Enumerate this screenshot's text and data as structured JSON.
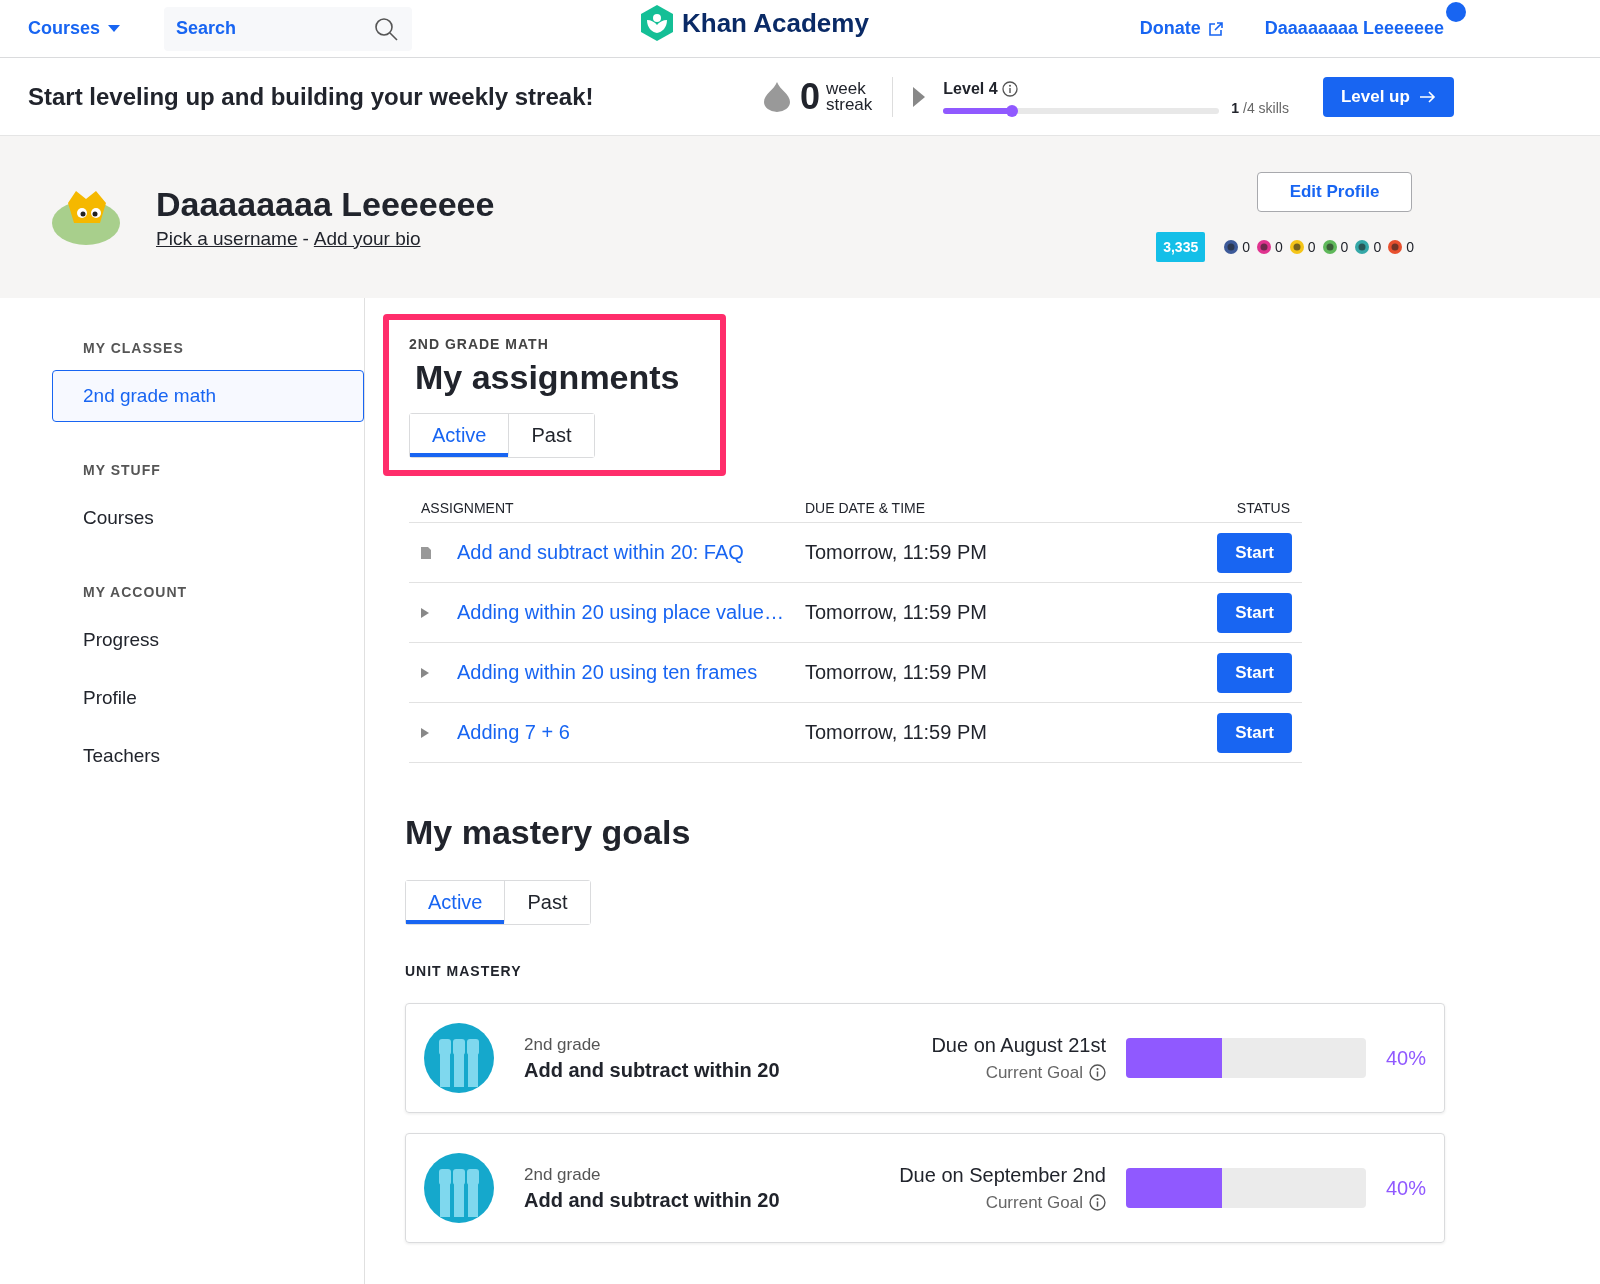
{
  "nav": {
    "courses": "Courses",
    "search": {
      "placeholder": "Search"
    },
    "logo": "Khan Academy",
    "donate": "Donate",
    "user": "Daaaaaaaa Leeeeeee",
    "notification": true
  },
  "streak_bar": {
    "message": "Start leveling up and building your weekly streak!",
    "streak_count": "0",
    "streak_label_1": "week",
    "streak_label_2": "streak",
    "level_label": "Level 4",
    "level": 0.25,
    "skills_done": "1",
    "skills_total": "/4 skills",
    "button": "Level up"
  },
  "profile": {
    "name": "Daaaaaaaa Leeeeeee",
    "link_1": "Pick a username",
    "separator": "-",
    "link_2": "Add your bio",
    "edit_button": "Edit Profile",
    "points": "3,335",
    "badges": [
      {
        "color": "#3d5a99",
        "count": "0"
      },
      {
        "color": "#e0338f",
        "count": "0"
      },
      {
        "color": "#f5c518",
        "count": "0"
      },
      {
        "color": "#5fb85a",
        "count": "0"
      },
      {
        "color": "#35a8a8",
        "count": "0"
      },
      {
        "color": "#e8502e",
        "count": "0"
      }
    ]
  },
  "sidebar": {
    "sections": [
      {
        "heading": "MY CLASSES",
        "items": [
          {
            "label": "2nd grade math",
            "selected": true
          }
        ]
      },
      {
        "heading": "MY STUFF",
        "items": [
          {
            "label": "Courses",
            "selected": false
          }
        ]
      },
      {
        "heading": "MY ACCOUNT",
        "items": [
          {
            "label": "Progress",
            "selected": false
          },
          {
            "label": "Profile",
            "selected": false
          },
          {
            "label": "Teachers",
            "selected": false
          }
        ]
      }
    ]
  },
  "assignments": {
    "class_label": "2ND GRADE MATH",
    "title": "My assignments",
    "highlighted": true,
    "tabs": [
      {
        "label": "Active",
        "selected": true
      },
      {
        "label": "Past",
        "selected": false
      }
    ],
    "columns": [
      "ASSIGNMENT",
      "DUE DATE & TIME",
      "STATUS"
    ],
    "rows": [
      {
        "kind": "article",
        "title": "Add and subtract within 20: FAQ",
        "due": "Tomorrow, 11:59 PM",
        "action": "Start"
      },
      {
        "kind": "video",
        "title": "Adding within 20 using place value…",
        "due": "Tomorrow, 11:59 PM",
        "action": "Start"
      },
      {
        "kind": "video",
        "title": "Adding within 20 using ten frames",
        "due": "Tomorrow, 11:59 PM",
        "action": "Start"
      },
      {
        "kind": "video",
        "title": "Adding 7 + 6",
        "due": "Tomorrow, 11:59 PM",
        "action": "Start"
      }
    ]
  },
  "mastery": {
    "title": "My mastery goals",
    "tabs": [
      {
        "label": "Active",
        "selected": true
      },
      {
        "label": "Past",
        "selected": false
      }
    ],
    "section_label": "UNIT MASTERY",
    "goals": [
      {
        "grade": "2nd grade",
        "unit": "Add and subtract within 20",
        "due": "Due on August 21st",
        "goal_label": "Current Goal",
        "level": 0.4,
        "percent": "40%"
      },
      {
        "grade": "2nd grade",
        "unit": "Add and subtract within 20",
        "due": "Due on September 2nd",
        "goal_label": "Current Goal",
        "level": 0.4,
        "percent": "40%"
      }
    ]
  }
}
